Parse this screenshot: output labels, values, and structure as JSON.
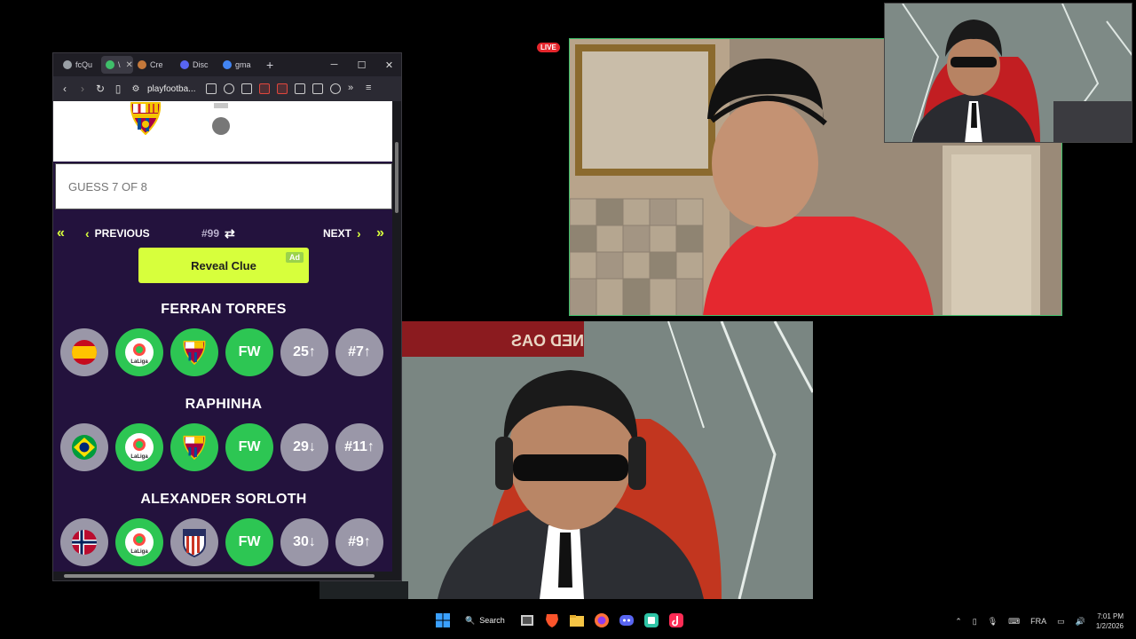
{
  "browser": {
    "tabs": [
      {
        "label": "fcQu",
        "fav": "#9aa0a6"
      },
      {
        "label": "\\",
        "fav": "#3fbf6a",
        "active": true
      },
      {
        "label": "Cre",
        "fav": "#c4783a"
      },
      {
        "label": "Disc",
        "fav": "#5865f2"
      },
      {
        "label": "gma",
        "fav": "#4285f4"
      }
    ],
    "url": "playfootba..."
  },
  "game": {
    "guess_placeholder": "GUESS 7 OF 8",
    "previous_label": "PREVIOUS",
    "next_label": "NEXT",
    "puzzle_number": "#99",
    "reveal_label": "Reveal Clue",
    "ad_label": "Ad",
    "players": [
      {
        "name": "FERRAN TORRES",
        "nation_flag": "spain-flag-icon",
        "league": "laliga-logo-icon",
        "club": "fc-barcelona-crest-icon",
        "position": "FW",
        "age": "25",
        "age_arrow": "↑",
        "shirt": "#7",
        "shirt_arrow": "↑"
      },
      {
        "name": "RAPHINHA",
        "nation_flag": "brazil-flag-icon",
        "league": "laliga-logo-icon",
        "club": "fc-barcelona-crest-icon",
        "position": "FW",
        "age": "29",
        "age_arrow": "↓",
        "shirt": "#11",
        "shirt_arrow": "↑"
      },
      {
        "name": "ALEXANDER SORLOTH",
        "nation_flag": "norway-flag-icon",
        "league": "laliga-logo-icon",
        "club": "atletico-madrid-crest-icon",
        "position": "FW",
        "age": "30",
        "age_arrow": "↓",
        "shirt": "#9",
        "shirt_arrow": "↑"
      }
    ],
    "colors": {
      "accent": "#d7ff3c",
      "correct": "#2dc653",
      "neutral": "#9a97a8",
      "bg": "#23123d"
    }
  },
  "stream": {
    "live_label": "LIVE"
  },
  "taskbar": {
    "search_label": "Search",
    "language": "FRA",
    "time": "7:01 PM",
    "date": "1/2/2026"
  }
}
